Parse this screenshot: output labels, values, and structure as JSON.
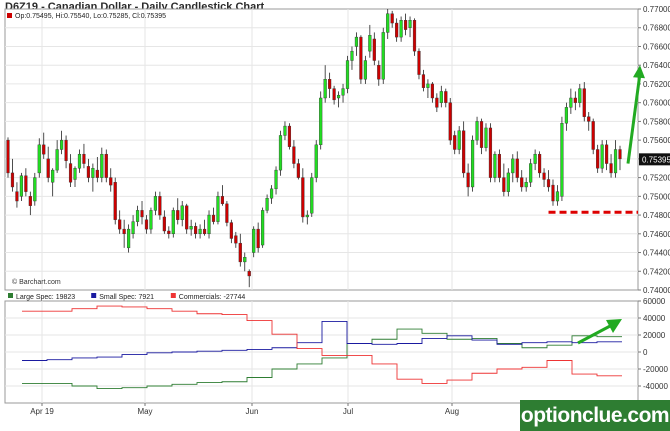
{
  "title": "D6Z19 - Canadian Dollar - Daily Candlestick Chart",
  "ohlc_legend": "Op:0.75495, Hi:0.75540, Lo:0.75285, Cl:0.75395",
  "source_note": "© Barchart.com",
  "last_price_label": "0.75395",
  "watermark": "optionclue.com",
  "colors": {
    "up": "#22dd22",
    "down": "#cc0000",
    "grid": "#e6e6e6",
    "large_spec": "#2e7d32",
    "small_spec": "#1a1aa0",
    "commercials": "#ee3333",
    "annotation_red": "#dd0000",
    "annotation_green": "#22aa22"
  },
  "chart_data": [
    {
      "type": "candlestick",
      "title": "D6Z19 - Canadian Dollar - Daily Candlestick Chart",
      "x_months": [
        "Apr 19",
        "May",
        "Jun",
        "Jul",
        "Aug"
      ],
      "y_ticks": [
        "0.77000",
        "0.76800",
        "0.76600",
        "0.76400",
        "0.76200",
        "0.76000",
        "0.75800",
        "0.75600",
        "0.75400",
        "0.75200",
        "0.75000",
        "0.74800",
        "0.74600",
        "0.74400",
        "0.74200",
        "0.74000"
      ],
      "ylim": [
        0.74,
        0.77
      ],
      "annotations": [
        {
          "kind": "dashed-level",
          "value": 0.7483,
          "color": "annotation_red"
        },
        {
          "kind": "up-arrow",
          "from": 0.7535,
          "to": 0.764,
          "color": "annotation_green"
        }
      ],
      "candles": [
        [
          0.756,
          0.7563,
          0.752,
          0.7525
        ],
        [
          0.7525,
          0.754,
          0.7505,
          0.751
        ],
        [
          0.7505,
          0.7515,
          0.7488,
          0.7495
        ],
        [
          0.75,
          0.7525,
          0.7495,
          0.7522
        ],
        [
          0.7522,
          0.753,
          0.75,
          0.7505
        ],
        [
          0.75,
          0.7505,
          0.748,
          0.749
        ],
        [
          0.7495,
          0.7525,
          0.749,
          0.752
        ],
        [
          0.7525,
          0.7562,
          0.752,
          0.7555
        ],
        [
          0.7555,
          0.7568,
          0.754,
          0.7545
        ],
        [
          0.754,
          0.7553,
          0.7515,
          0.752
        ],
        [
          0.7515,
          0.753,
          0.75,
          0.7528
        ],
        [
          0.7528,
          0.756,
          0.7525,
          0.755
        ],
        [
          0.755,
          0.757,
          0.7545,
          0.756
        ],
        [
          0.756,
          0.7565,
          0.753,
          0.7538
        ],
        [
          0.7535,
          0.7545,
          0.751,
          0.7515
        ],
        [
          0.7518,
          0.7532,
          0.751,
          0.753
        ],
        [
          0.753,
          0.755,
          0.7525,
          0.7545
        ],
        [
          0.7545,
          0.7556,
          0.753,
          0.7535
        ],
        [
          0.7532,
          0.754,
          0.7515,
          0.752
        ],
        [
          0.752,
          0.7535,
          0.7505,
          0.753
        ],
        [
          0.7528,
          0.7542,
          0.7515,
          0.752
        ],
        [
          0.752,
          0.7552,
          0.7515,
          0.7545
        ],
        [
          0.7545,
          0.755,
          0.7515,
          0.752
        ],
        [
          0.752,
          0.753,
          0.7505,
          0.7512
        ],
        [
          0.7515,
          0.752,
          0.747,
          0.7475
        ],
        [
          0.7475,
          0.7485,
          0.746,
          0.7465
        ],
        [
          0.7465,
          0.7475,
          0.7445,
          0.746
        ],
        [
          0.7445,
          0.747,
          0.744,
          0.7465
        ],
        [
          0.746,
          0.748,
          0.7455,
          0.7473
        ],
        [
          0.7473,
          0.749,
          0.7468,
          0.7485
        ],
        [
          0.7485,
          0.7495,
          0.747,
          0.7478
        ],
        [
          0.7475,
          0.748,
          0.746,
          0.7465
        ],
        [
          0.7465,
          0.7488,
          0.746,
          0.7485
        ],
        [
          0.7485,
          0.7505,
          0.748,
          0.75
        ],
        [
          0.75,
          0.7505,
          0.7475,
          0.748
        ],
        [
          0.7478,
          0.7485,
          0.746,
          0.7463
        ],
        [
          0.7463,
          0.7468,
          0.7455,
          0.746
        ],
        [
          0.746,
          0.7488,
          0.7456,
          0.7485
        ],
        [
          0.7485,
          0.7498,
          0.747,
          0.7475
        ],
        [
          0.7475,
          0.7495,
          0.7468,
          0.749
        ],
        [
          0.749,
          0.7492,
          0.746,
          0.7465
        ],
        [
          0.7465,
          0.7475,
          0.7458,
          0.7468
        ],
        [
          0.7468,
          0.7472,
          0.7455,
          0.746
        ],
        [
          0.746,
          0.747,
          0.7455,
          0.7465
        ],
        [
          0.7465,
          0.7475,
          0.7458,
          0.746
        ],
        [
          0.746,
          0.7485,
          0.7455,
          0.748
        ],
        [
          0.748,
          0.7488,
          0.747,
          0.7473
        ],
        [
          0.7473,
          0.7505,
          0.747,
          0.75
        ],
        [
          0.75,
          0.7512,
          0.749,
          0.7492
        ],
        [
          0.7492,
          0.7495,
          0.7468,
          0.7472
        ],
        [
          0.7472,
          0.7475,
          0.745,
          0.7455
        ],
        [
          0.7458,
          0.7462,
          0.7445,
          0.745
        ],
        [
          0.745,
          0.746,
          0.7425,
          0.743
        ],
        [
          0.743,
          0.744,
          0.742,
          0.7435
        ],
        [
          0.742,
          0.7422,
          0.7403,
          0.7415
        ],
        [
          0.744,
          0.7468,
          0.7435,
          0.7465
        ],
        [
          0.7465,
          0.7472,
          0.744,
          0.7445
        ],
        [
          0.7448,
          0.7488,
          0.7445,
          0.7485
        ],
        [
          0.7485,
          0.7502,
          0.7482,
          0.7498
        ],
        [
          0.7498,
          0.7512,
          0.7492,
          0.7508
        ],
        [
          0.7508,
          0.7532,
          0.7502,
          0.7528
        ],
        [
          0.7528,
          0.757,
          0.7522,
          0.7565
        ],
        [
          0.7565,
          0.758,
          0.756,
          0.7575
        ],
        [
          0.7575,
          0.7578,
          0.755,
          0.7553
        ],
        [
          0.7553,
          0.756,
          0.753,
          0.7535
        ],
        [
          0.7535,
          0.754,
          0.7518,
          0.752
        ],
        [
          0.752,
          0.753,
          0.7472,
          0.7478
        ],
        [
          0.7478,
          0.7485,
          0.747,
          0.748
        ],
        [
          0.7482,
          0.7525,
          0.7478,
          0.752
        ],
        [
          0.752,
          0.756,
          0.7515,
          0.7555
        ],
        [
          0.7555,
          0.7612,
          0.755,
          0.7605
        ],
        [
          0.7605,
          0.764,
          0.76,
          0.7625
        ],
        [
          0.7625,
          0.7632,
          0.7605,
          0.7615
        ],
        [
          0.7615,
          0.7618,
          0.7598,
          0.7603
        ],
        [
          0.7605,
          0.7612,
          0.7595,
          0.7608
        ],
        [
          0.7608,
          0.762,
          0.76,
          0.7615
        ],
        [
          0.7615,
          0.765,
          0.761,
          0.7645
        ],
        [
          0.7645,
          0.766,
          0.7635,
          0.7655
        ],
        [
          0.766,
          0.7675,
          0.765,
          0.767
        ],
        [
          0.767,
          0.7672,
          0.762,
          0.7625
        ],
        [
          0.7625,
          0.765,
          0.762,
          0.7645
        ],
        [
          0.7655,
          0.7683,
          0.7648,
          0.7672
        ],
        [
          0.7668,
          0.7675,
          0.764,
          0.7645
        ],
        [
          0.764,
          0.7645,
          0.7618,
          0.7625
        ],
        [
          0.7625,
          0.768,
          0.762,
          0.7675
        ],
        [
          0.7675,
          0.77,
          0.7668,
          0.7695
        ],
        [
          0.7695,
          0.7698,
          0.768,
          0.7685
        ],
        [
          0.7685,
          0.769,
          0.7665,
          0.767
        ],
        [
          0.767,
          0.7692,
          0.7665,
          0.7688
        ],
        [
          0.7688,
          0.7695,
          0.7672,
          0.7678
        ],
        [
          0.768,
          0.7692,
          0.767,
          0.7688
        ],
        [
          0.7688,
          0.769,
          0.765,
          0.7655
        ],
        [
          0.7655,
          0.7658,
          0.7625,
          0.763
        ],
        [
          0.763,
          0.7635,
          0.7612,
          0.7616
        ],
        [
          0.7616,
          0.7625,
          0.7605,
          0.762
        ],
        [
          0.762,
          0.7622,
          0.76,
          0.7605
        ],
        [
          0.7605,
          0.761,
          0.759,
          0.7595
        ],
        [
          0.76,
          0.7618,
          0.7595,
          0.7612
        ],
        [
          0.7612,
          0.7615,
          0.7595,
          0.76
        ],
        [
          0.76,
          0.7605,
          0.7555,
          0.756
        ],
        [
          0.7565,
          0.757,
          0.7545,
          0.755
        ],
        [
          0.755,
          0.7575,
          0.7545,
          0.757
        ],
        [
          0.757,
          0.758,
          0.752,
          0.7525
        ],
        [
          0.7525,
          0.7535,
          0.75,
          0.751
        ],
        [
          0.751,
          0.7565,
          0.7505,
          0.756
        ],
        [
          0.756,
          0.7585,
          0.7555,
          0.758
        ],
        [
          0.758,
          0.7583,
          0.7545,
          0.7552
        ],
        [
          0.7552,
          0.7578,
          0.7548,
          0.7573
        ],
        [
          0.7573,
          0.7578,
          0.7515,
          0.752
        ],
        [
          0.752,
          0.7548,
          0.7515,
          0.7545
        ],
        [
          0.7545,
          0.755,
          0.7515,
          0.752
        ],
        [
          0.752,
          0.7535,
          0.75,
          0.7505
        ],
        [
          0.7505,
          0.753,
          0.75,
          0.7525
        ],
        [
          0.7525,
          0.7545,
          0.7515,
          0.754
        ],
        [
          0.754,
          0.7548,
          0.7515,
          0.752
        ],
        [
          0.752,
          0.7528,
          0.7505,
          0.751
        ],
        [
          0.751,
          0.752,
          0.7505,
          0.7515
        ],
        [
          0.7515,
          0.754,
          0.751,
          0.7535
        ],
        [
          0.7535,
          0.755,
          0.7528,
          0.7545
        ],
        [
          0.7545,
          0.7548,
          0.752,
          0.7525
        ],
        [
          0.7525,
          0.753,
          0.751,
          0.7518
        ],
        [
          0.7518,
          0.7528,
          0.7505,
          0.751
        ],
        [
          0.7512,
          0.7518,
          0.749,
          0.7495
        ],
        [
          0.7495,
          0.7512,
          0.749,
          0.7505
        ],
        [
          0.75,
          0.7585,
          0.7495,
          0.7578
        ],
        [
          0.7578,
          0.76,
          0.757,
          0.7595
        ],
        [
          0.7595,
          0.7615,
          0.7588,
          0.7605
        ],
        [
          0.7605,
          0.7612,
          0.7592,
          0.76
        ],
        [
          0.76,
          0.762,
          0.7595,
          0.7615
        ],
        [
          0.7615,
          0.7622,
          0.758,
          0.7585
        ],
        [
          0.7585,
          0.759,
          0.757,
          0.758
        ],
        [
          0.758,
          0.7583,
          0.7545,
          0.755
        ],
        [
          0.755,
          0.7555,
          0.7525,
          0.753
        ],
        [
          0.753,
          0.756,
          0.7525,
          0.7555
        ],
        [
          0.7555,
          0.756,
          0.7528,
          0.7535
        ],
        [
          0.7535,
          0.7545,
          0.752,
          0.7525
        ],
        [
          0.7525,
          0.756,
          0.752,
          0.755
        ],
        [
          0.755,
          0.7554,
          0.7528,
          0.754
        ]
      ]
    },
    {
      "type": "line",
      "title": "Commitment of Traders",
      "y_ticks": [
        "60000",
        "40000",
        "20000",
        "0",
        "-20000",
        "-40000",
        "-60000"
      ],
      "ylim": [
        -60000,
        60000
      ],
      "series": [
        {
          "name": "Large Spec: 19823",
          "color": "large_spec",
          "values": [
            -37000,
            -37000,
            -40000,
            -43000,
            -42000,
            -40000,
            -38000,
            -36000,
            -35000,
            -30000,
            -20000,
            -14000,
            -7000,
            10000,
            15000,
            27000,
            22000,
            15000,
            16000,
            10000,
            5000,
            8000,
            19000,
            18000
          ]
        },
        {
          "name": "Small Spec: 7921",
          "color": "small_spec",
          "values": [
            -10000,
            -9000,
            -7000,
            -6000,
            -3000,
            -1000,
            0,
            1000,
            2000,
            3000,
            5000,
            11000,
            36000,
            10000,
            9000,
            10000,
            16000,
            19000,
            14000,
            9000,
            11000,
            12000,
            11000,
            12000
          ]
        },
        {
          "name": "Commercials: -27744",
          "color": "commercials",
          "values": [
            48000,
            48000,
            51000,
            54000,
            53000,
            51000,
            48000,
            45000,
            44000,
            37000,
            21000,
            4000,
            -4000,
            -4000,
            -14000,
            -32000,
            -37000,
            -33000,
            -25000,
            -20000,
            -18000,
            -10000,
            -26000,
            -28000
          ]
        }
      ]
    }
  ]
}
